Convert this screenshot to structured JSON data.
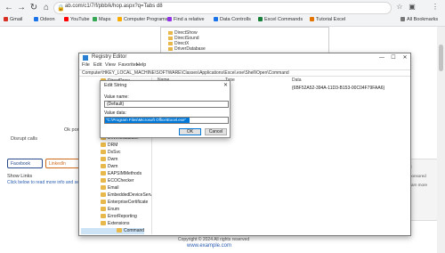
{
  "browser": {
    "back": "←",
    "forward": "→",
    "reload": "↻",
    "home": "⌂",
    "url": "ab.com/c1/7/f/pbb/k/hop.aspx?q=Tabs d8",
    "lock": "🔒",
    "star": "☆",
    "ext": "▣",
    "menu": "⋮",
    "bookmarks": [
      {
        "label": "Gmail",
        "color": "#d93025"
      },
      {
        "label": "Odeon",
        "color": "#1a73e8"
      },
      {
        "label": "YouTube",
        "color": "#ff0000"
      },
      {
        "label": "Maps",
        "color": "#34a853"
      },
      {
        "label": "Computer Programs",
        "color": "#f9ab00"
      },
      {
        "label": "Find a relative",
        "color": "#9334e6"
      },
      {
        "label": "Data Controlls",
        "color": "#1a73e8"
      },
      {
        "label": "Excel Commands",
        "color": "#188038"
      },
      {
        "label": "Tutorial Excel",
        "color": "#e37400"
      },
      {
        "label": "All Bookmarks",
        "color": "#777777"
      }
    ]
  },
  "page": {
    "left_label_1": "Ok port",
    "left_label_2": "Disrupt calls",
    "share_fb": "Facebook",
    "share_li": "LinkedIn",
    "bottom_text": "Show Links",
    "bottom_link": "Click below to read more info and settings",
    "bgtree_lines": [
      "DirectShow",
      "DirectSound",
      "DirectX",
      "DriverDatabase"
    ],
    "ad_lines": [
      "Ad",
      "Sponsored",
      "Learn more"
    ],
    "footer": "Copyright © 2024 All rights reserved",
    "footer_link": "www.example.com"
  },
  "regedit": {
    "title": "Registry Editor",
    "minimize": "—",
    "maximize": "☐",
    "close": "✕",
    "menu": [
      "File",
      "Edit",
      "View",
      "Favorites",
      "Help"
    ],
    "address": "Computer\\HKEY_LOCAL_MACHINE\\SOFTWARE\\Classes\\Applications\\Excel.exe\\Shell\\Open\\Command",
    "tree": [
      "DirectDraw",
      "DirectInput",
      "DirectMusic",
      "DirectPlay",
      "DirectPlay8",
      "DirectPlayNATHelp",
      "DirectShow",
      "DirectX",
      "DriverDatabase",
      "DRM",
      "DsSvc",
      "Dwm",
      "Dwm",
      "EAPSIMMethods",
      "ECOChecker",
      "Email",
      "EmbeddedDeviceServ",
      "EnterpriseCertificate",
      "Enum",
      "ErrorReporting",
      "Extensions",
      "Command"
    ],
    "list_headers": {
      "name": "Name",
      "type": "Type",
      "data": "Data"
    },
    "list_data": "{6BF52A52-394A-11D3-B153-00C04F79FAA6}"
  },
  "dialog": {
    "title": "Edit String",
    "close": "✕",
    "name_label": "Value name:",
    "name_value": "(Default)",
    "data_label": "Value data:",
    "data_value": "\"C:\\Program Files\\Microsoft Office\\Excel.exe\"",
    "ok": "OK",
    "cancel": "Cancel"
  }
}
